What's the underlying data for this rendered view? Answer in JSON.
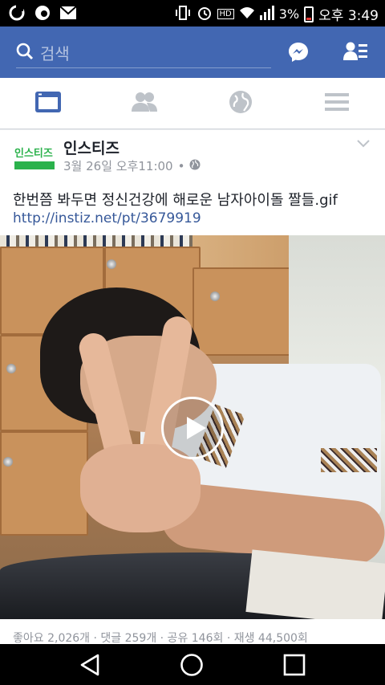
{
  "status_bar": {
    "battery": "3%",
    "time": "오후 3:49",
    "hd_label": "HD"
  },
  "header": {
    "search_placeholder": "검색",
    "icons": [
      "search-icon",
      "messenger-icon",
      "friend-requests-icon"
    ],
    "color": "#4267b2"
  },
  "tabs": [
    {
      "name": "news-feed",
      "icon": "news-feed-icon",
      "active": true
    },
    {
      "name": "friends",
      "icon": "friends-icon",
      "active": false
    },
    {
      "name": "notifications",
      "icon": "globe-icon",
      "active": false
    },
    {
      "name": "menu",
      "icon": "menu-icon",
      "active": false
    }
  ],
  "post": {
    "page_logo_text": "인스티즈",
    "page_name": "인스티즈",
    "timestamp": "3월 26일 오후11:00",
    "separator": "•",
    "text": "한번쯤 봐두면 정신건강에 해로운 남자아이돌 짤들.gif",
    "link": "http://instiz.net/pt/3679919",
    "stats": "좋아요 2,026개 · 댓글 259개 · 공유 146회 · 재생 44,500회"
  },
  "colors": {
    "link": "#365899",
    "brand_green": "#2bb24c",
    "meta_gray": "#90949c"
  }
}
